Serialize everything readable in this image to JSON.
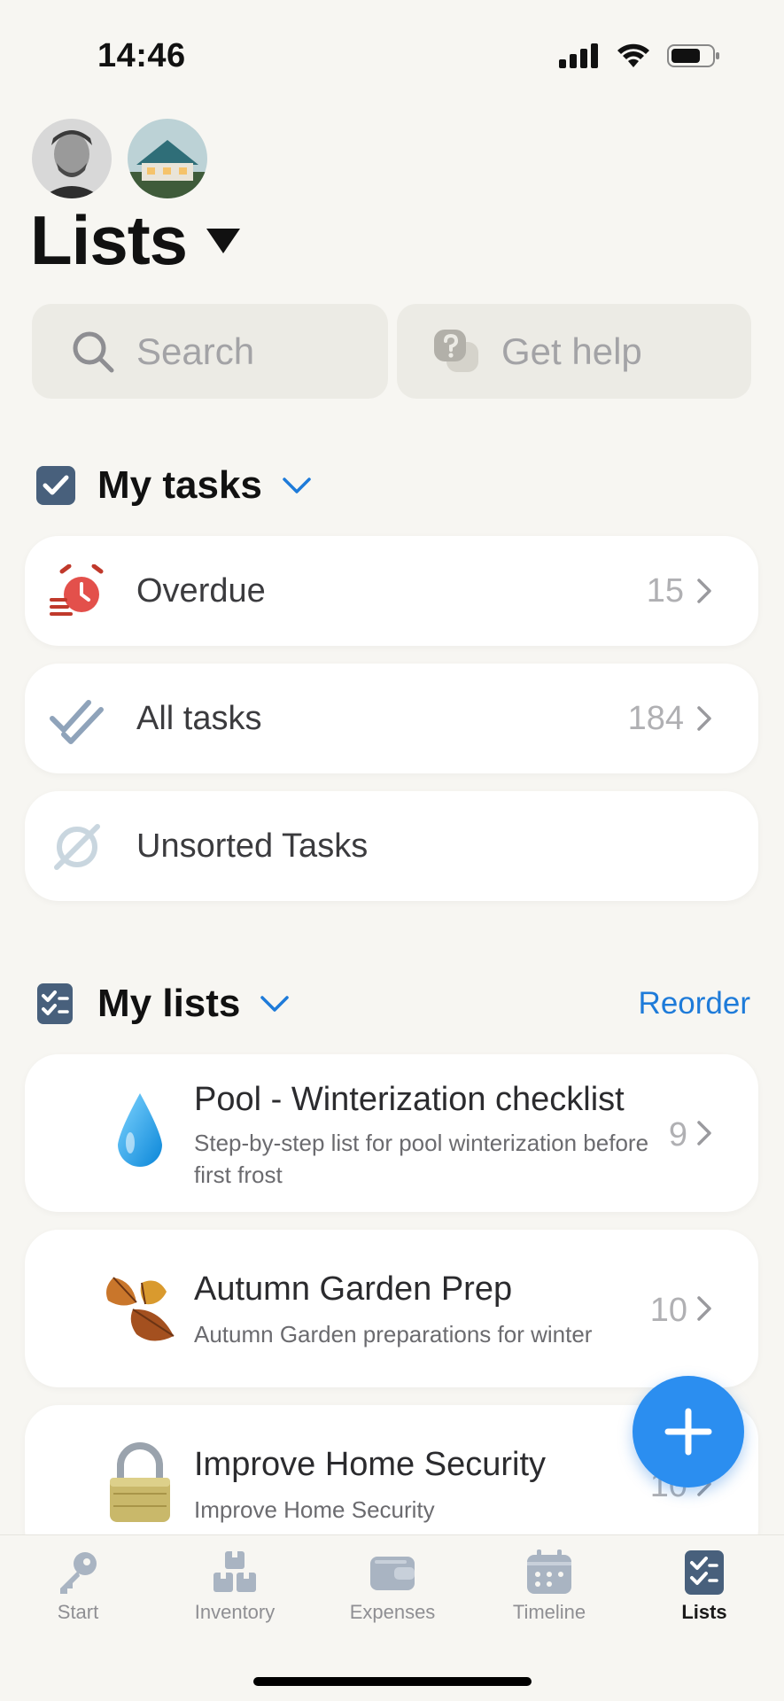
{
  "status_bar": {
    "time": "14:46"
  },
  "header": {
    "title": "Lists",
    "avatars": [
      "user-avatar",
      "home-avatar"
    ]
  },
  "search": {
    "placeholder": "Search"
  },
  "help": {
    "label": "Get help"
  },
  "my_tasks": {
    "title": "My tasks",
    "items": [
      {
        "label": "Overdue",
        "count": "15",
        "icon": "alarm-clock-icon"
      },
      {
        "label": "All tasks",
        "count": "184",
        "icon": "double-check-icon"
      },
      {
        "label": "Unsorted Tasks",
        "count": "",
        "icon": "empty-set-icon"
      }
    ]
  },
  "my_lists": {
    "title": "My lists",
    "reorder_label": "Reorder",
    "items": [
      {
        "title": "Pool - Winterization checklist",
        "desc": "Step-by-step list for pool winterization before first frost",
        "count": "9",
        "icon": "water-drop-icon"
      },
      {
        "title": "Autumn Garden Prep",
        "desc": "Autumn Garden preparations for winter",
        "count": "10",
        "icon": "autumn-leaves-icon"
      },
      {
        "title": "Improve Home Security",
        "desc": "Improve Home Security",
        "count": "10",
        "icon": "padlock-icon"
      }
    ]
  },
  "tabs": [
    {
      "label": "Start",
      "icon": "key-icon",
      "active": false
    },
    {
      "label": "Inventory",
      "icon": "boxes-icon",
      "active": false
    },
    {
      "label": "Expenses",
      "icon": "wallet-icon",
      "active": false
    },
    {
      "label": "Timeline",
      "icon": "calendar-icon",
      "active": false
    },
    {
      "label": "Lists",
      "icon": "checklist-icon",
      "active": true
    }
  ],
  "colors": {
    "background": "#f7f6f2",
    "accent": "#1e7bd9",
    "fab": "#2b8ef0",
    "overdue": "#e3504b"
  }
}
